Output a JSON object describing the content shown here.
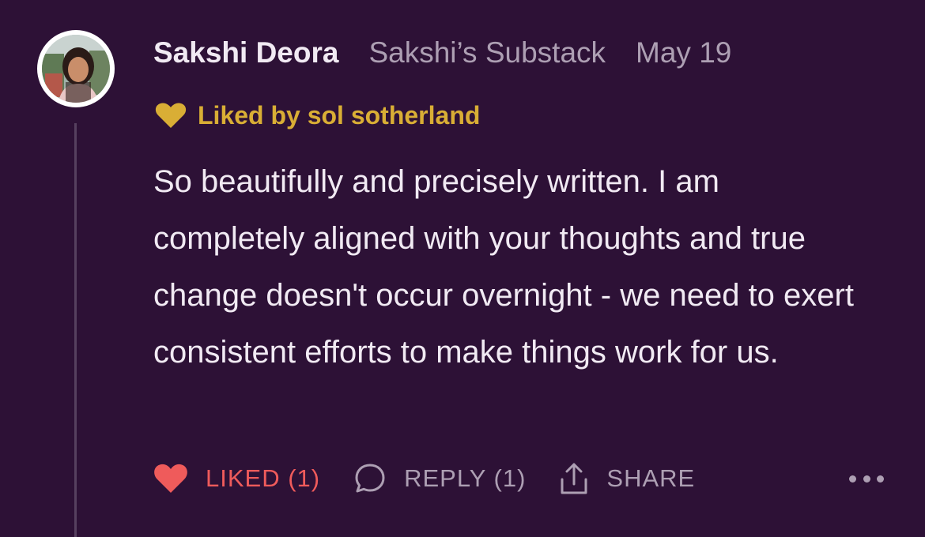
{
  "comment": {
    "author": "Sakshi Deora",
    "publication": "Sakshi’s Substack",
    "date": "May 19",
    "liked_by": "Liked by sol sotherland",
    "body": "So beautifully and precisely written. I am completely aligned with your thoughts and true change doesn't occur overnight - we need to exert consistent efforts to make things work for us.",
    "avatar_icon": "user-photo-avatar",
    "liked_by_icon": "heart-icon"
  },
  "actions": {
    "like_label": "LIKED (1)",
    "reply_label": "REPLY (1)",
    "share_label": "SHARE",
    "like_icon": "heart-icon",
    "reply_icon": "speech-bubble-icon",
    "share_icon": "share-upload-icon",
    "more_icon": "more-dots-icon"
  },
  "colors": {
    "background": "#2d1136",
    "text": "#f1eaf3",
    "muted": "#ad9fb3",
    "liked_by_gold": "#d9ae35",
    "liked_red": "#ef5b5b",
    "thread_line": "#56405f"
  }
}
